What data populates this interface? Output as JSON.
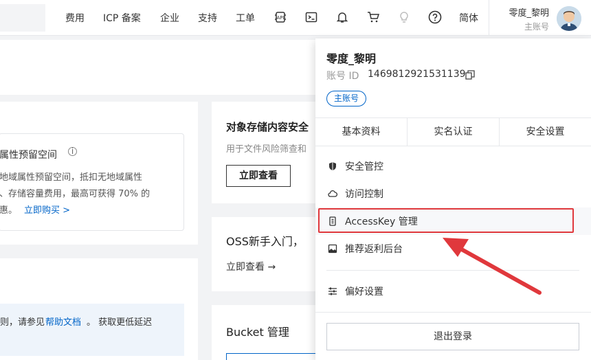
{
  "header": {
    "nav": [
      "费用",
      "ICP 备案",
      "企业",
      "支持",
      "工单"
    ],
    "icons": [
      "api-icon",
      "terminal-icon",
      "bell-icon",
      "cart-icon",
      "bulb-icon",
      "help-icon"
    ],
    "language": "简体",
    "user": {
      "name": "零度_黎明",
      "role": "主账号"
    }
  },
  "background": {
    "promo_title": "属性预留空间",
    "promo_lines": [
      "地域属性预留空间，抵扣无地域属性",
      "、存储容量费用，最高可获得 70% 的",
      "惠。"
    ],
    "promo_link": "立即购买 >",
    "card1_title": "对象存储内容安全",
    "card1_desc": "用于文件风险筛查和",
    "card1_button": "立即查看",
    "card2_title": "OSS新手入门，",
    "card2_link": "立即查看 →",
    "info_prefix": "则，请参见",
    "info_link": "帮助文档",
    "info_suffix": "。 获取更低延迟",
    "bucket_title": "Bucket 管理"
  },
  "dropdown": {
    "name": "零度_黎明",
    "account_id_label": "账号 ID",
    "account_id": "1469812921531139",
    "badge": "主账号",
    "tabs": [
      "基本资料",
      "实名认证",
      "安全设置"
    ],
    "menu": [
      {
        "label": "安全管控",
        "icon": "shield-icon"
      },
      {
        "label": "访问控制",
        "icon": "cloud-icon"
      },
      {
        "label": "AccessKey 管理",
        "icon": "key-icon"
      },
      {
        "label": "推荐返利后台",
        "icon": "image-icon"
      },
      {
        "label": "偏好设置",
        "icon": "sliders-icon"
      }
    ],
    "logout": "退出登录"
  },
  "colors": {
    "accent": "#0064c8",
    "highlight": "#e0383c"
  }
}
